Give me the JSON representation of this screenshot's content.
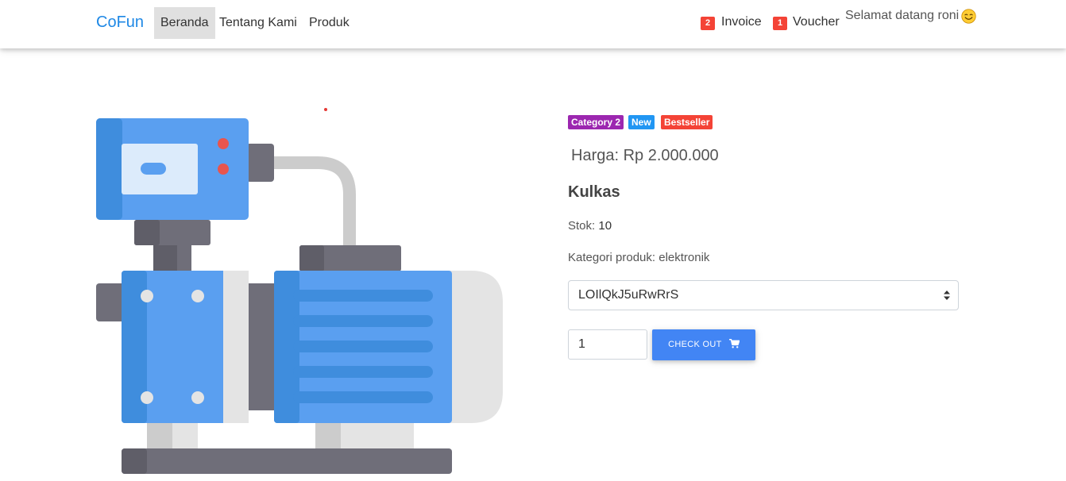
{
  "navbar": {
    "brand": "CoFun",
    "links": [
      "Beranda",
      "Tentang Kami",
      "Produk"
    ],
    "invoice": {
      "count": "2",
      "label": "Invoice"
    },
    "voucher": {
      "count": "1",
      "label": "Voucher"
    },
    "welcome": "Selamat datang roni",
    "welcome_icon": "smiley-icon"
  },
  "product": {
    "image_icon": "water-pump-icon",
    "badges": [
      {
        "label": "Category 2",
        "color": "#9c27b0"
      },
      {
        "label": "New",
        "color": "#2196f3"
      },
      {
        "label": "Bestseller",
        "color": "#f44336"
      }
    ],
    "price": "Harga: Rp 2.000.000",
    "name": "Kulkas",
    "stock_label": "Stok:",
    "stock_value": "10",
    "category": "Kategori produk: elektronik",
    "variant_selected": "LOIlQkJ5uRwRrS",
    "quantity": "1",
    "checkout_label": "CHECK OUT",
    "checkout_icon": "cart-icon"
  },
  "colors": {
    "brand": "#1e88e5",
    "primary_button": "#4285f4",
    "badge_red": "#f44336"
  }
}
